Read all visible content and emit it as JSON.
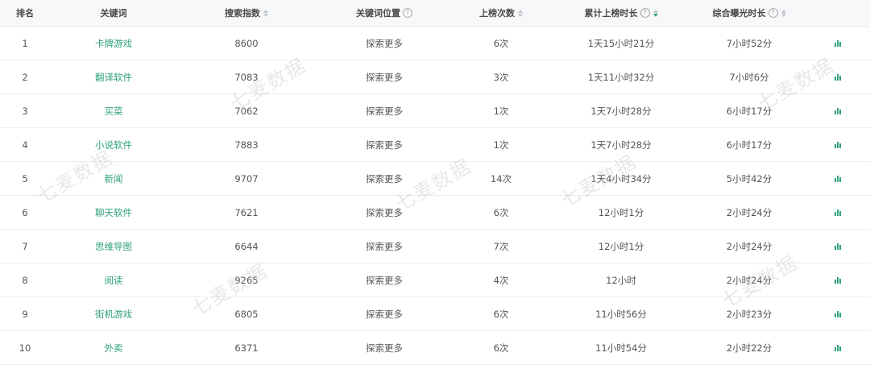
{
  "table": {
    "headers": {
      "rank": "排名",
      "keyword": "关键词",
      "search_index": "搜索指数",
      "keyword_position": "关键词位置",
      "rank_count": "上榜次数",
      "total_duration": "累计上榜时长",
      "exposure_duration": "综合曝光时长"
    },
    "rows": [
      {
        "rank": "1",
        "keyword": "卡牌游戏",
        "index": "8600",
        "position": "探索更多",
        "count": "6次",
        "duration": "1天15小时21分",
        "exposure": "7小时52分"
      },
      {
        "rank": "2",
        "keyword": "翻译软件",
        "index": "7083",
        "position": "探索更多",
        "count": "3次",
        "duration": "1天11小时32分",
        "exposure": "7小时6分"
      },
      {
        "rank": "3",
        "keyword": "买菜",
        "index": "7062",
        "position": "探索更多",
        "count": "1次",
        "duration": "1天7小时28分",
        "exposure": "6小时17分"
      },
      {
        "rank": "4",
        "keyword": "小说软件",
        "index": "7883",
        "position": "探索更多",
        "count": "1次",
        "duration": "1天7小时28分",
        "exposure": "6小时17分"
      },
      {
        "rank": "5",
        "keyword": "新闻",
        "index": "9707",
        "position": "探索更多",
        "count": "14次",
        "duration": "1天4小时34分",
        "exposure": "5小时42分"
      },
      {
        "rank": "6",
        "keyword": "聊天软件",
        "index": "7621",
        "position": "探索更多",
        "count": "6次",
        "duration": "12小时1分",
        "exposure": "2小时24分"
      },
      {
        "rank": "7",
        "keyword": "思维导图",
        "index": "6644",
        "position": "探索更多",
        "count": "7次",
        "duration": "12小时1分",
        "exposure": "2小时24分"
      },
      {
        "rank": "8",
        "keyword": "阅读",
        "index": "9265",
        "position": "探索更多",
        "count": "4次",
        "duration": "12小时",
        "exposure": "2小时24分"
      },
      {
        "rank": "9",
        "keyword": "街机游戏",
        "index": "6805",
        "position": "探索更多",
        "count": "6次",
        "duration": "11小时56分",
        "exposure": "2小时23分"
      },
      {
        "rank": "10",
        "keyword": "外卖",
        "index": "6371",
        "position": "探索更多",
        "count": "6次",
        "duration": "11小时54分",
        "exposure": "2小时22分"
      }
    ]
  },
  "watermark": {
    "text": "七麦数据"
  },
  "colors": {
    "accent": "#2fa27a",
    "header_bg": "#f7f8fa",
    "border": "#ececec"
  },
  "icons": {
    "help": "question-circle-icon",
    "sort": "sort-caret-icon",
    "trend": "bar-chart-icon"
  }
}
